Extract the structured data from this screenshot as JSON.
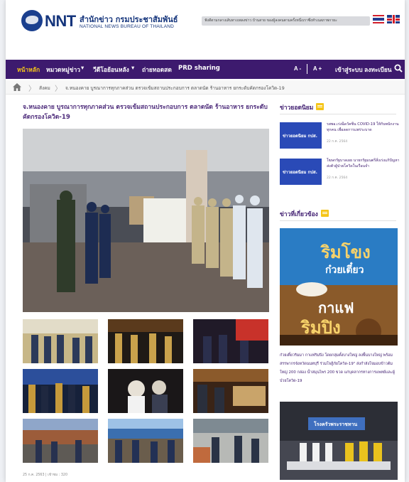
{
  "header": {
    "logo_text": "NNT",
    "logo_th": "สำนักข่าว กรมประชาสัมพันธ์",
    "logo_en": "NATIONAL NEWS BUREAU OF THAILAND",
    "ticker": "ฟังดีตามกลางเส้นทางเพลงข่าว บ้านสาย ของผู้ลงคนตามครั้งหนึ่งเราซึ่งทำเนสภาพกายะ"
  },
  "nav": {
    "items": [
      "หน้าหลัก",
      "หมวดหมู่ข่าว",
      "วีดีโอย้อนหลัง",
      "ถ่ายทอดสด",
      "PRD sharing"
    ],
    "font_minus": "A -",
    "font_plus": "A +",
    "login": "เข้าสู่ระบบ",
    "register": "ลงทะเบียน"
  },
  "breadcrumb": {
    "section": "สังคม",
    "current": "จ.หนองคาย บูรณาการทุกภาคส่วน ตรวจเข้มสถานประกอบการ ตลาดนัด ร้านอาหาร ยกระดับคัดกรองโควิด-19"
  },
  "article": {
    "title": "จ.หนองคาย บูรณาการทุกภาคส่วน ตรวจเข้มสถานประกอบการ ตลาดนัด ร้านอาหาร ยกระดับคัดกรองโควิด-19",
    "meta": "25 ก.ค. 2563 | เข้าชม : 320"
  },
  "sidebar": {
    "popular_heading": "ข่าวยอดนิยม",
    "popular": [
      {
        "thumb_label": "ข่าวยอดนิยม กปส.",
        "title": "รสพอ.เร่งฉีดวัคซีน COVID-19 ให้กับพนักงานทุกคน เพื่อลดการแพร่ระบาด",
        "date": "22 ก.ค. 2564"
      },
      {
        "thumb_label": "ข่าวยอดนิยม กปส.",
        "title": "โฆษกรัฐบาลเผย นายกรัฐมนตรีสั่งเร่งแก้ปัญหาส่งตัวผู้ป่วยโควิดในเรือนจำ",
        "date": "22 ก.ค. 2564"
      }
    ],
    "related_heading": "ข่าวที่เกี่ยวข้อง",
    "promo_text_1": "ริมโขง",
    "promo_text_2": "ก๋วยเตี๋ยว",
    "promo_text_3": "กาแฟ",
    "promo_text_4": "ริมปิง",
    "promo_desc": "ก๋วยเตี๋ยวริมมา กาแฟริมปิง โดยกลุ่มตั้งบางใหญ่ ลงพื้นบางใหญ่ พร้อม สรรพากรจังหวัดนนทบุรี ร่วมใจสู้ภัยโควิด-19\" ส่งกำลังใจมอบข้าวต้มใหญ่ 200 กล่อง น้ำสมุนไพร 200 ขวด แก่บุคลากรทางการแพทย์และผู้ป่วยโควิด-19",
    "banner_text": "โรงครัวพระราชทาน"
  },
  "colors": {
    "nav_bg": "#3d1a6e",
    "accent_yellow": "#f5c518",
    "title_purple": "#4c2a7a",
    "brand_blue": "#15357c"
  }
}
